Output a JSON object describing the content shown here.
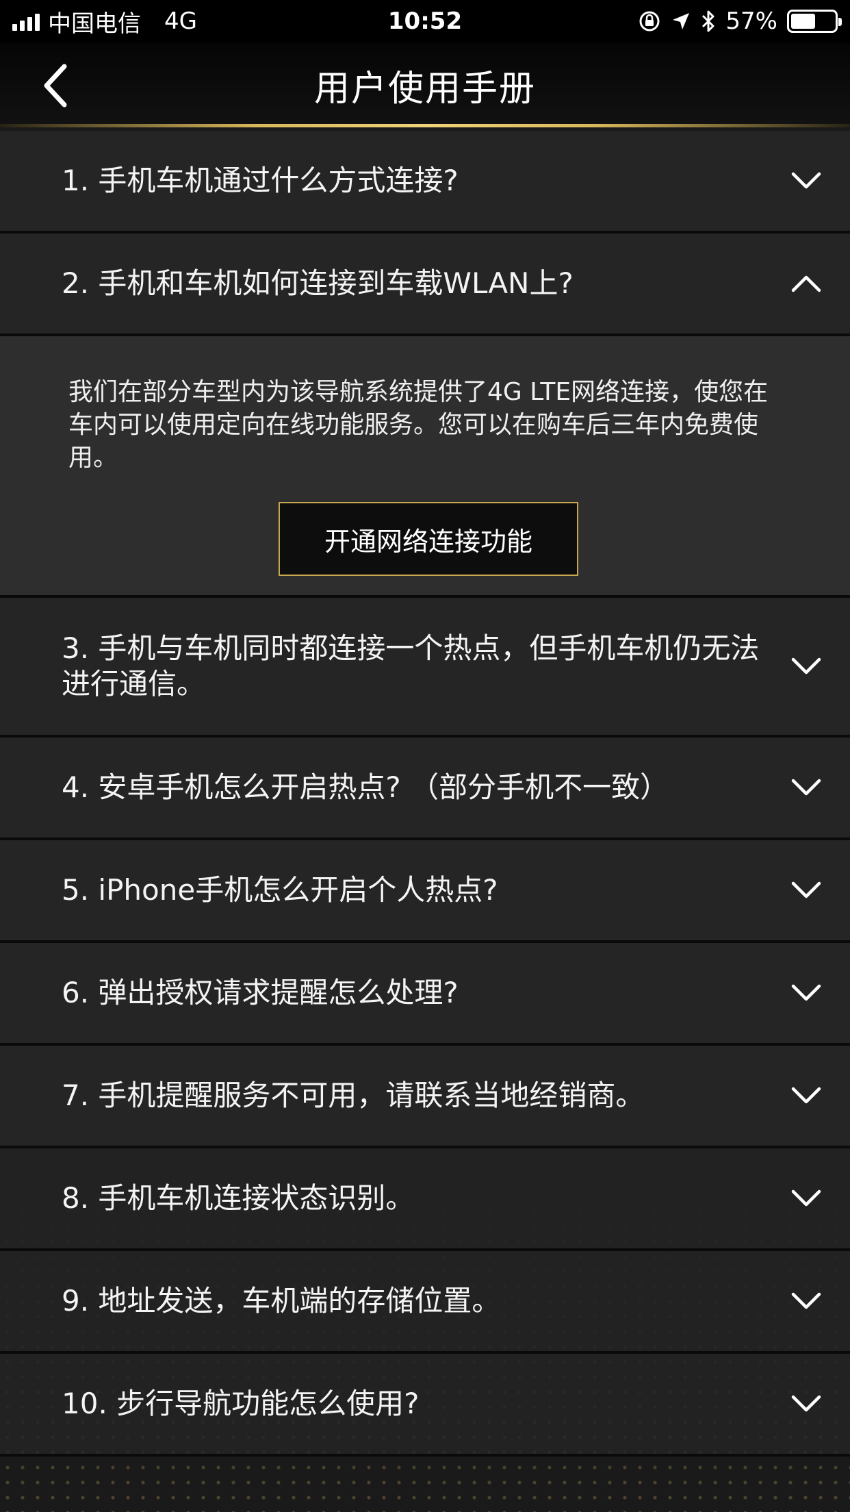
{
  "status_bar": {
    "carrier": "中国电信",
    "network": "4G",
    "time": "10:52",
    "battery": "57%",
    "battery_level": 0.57
  },
  "nav": {
    "title": "用户使用手册",
    "back_icon": "chevron-left-icon"
  },
  "faq": {
    "items": [
      {
        "question": "1. 手机车机通过什么方式连接?",
        "expanded": false
      },
      {
        "question": "2. 手机和车机如何连接到车载WLAN上?",
        "expanded": true
      },
      {
        "question": "3. 手机与车机同时都连接一个热点，但手机车机仍无法进行通信。",
        "expanded": false
      },
      {
        "question": "4. 安卓手机怎么开启热点? （部分手机不一致）",
        "expanded": false
      },
      {
        "question": "5. iPhone手机怎么开启个人热点?",
        "expanded": false
      },
      {
        "question": "6. 弹出授权请求提醒怎么处理?",
        "expanded": false
      },
      {
        "question": "7. 手机提醒服务不可用，请联系当地经销商。",
        "expanded": false
      },
      {
        "question": "8. 手机车机连接状态识别。",
        "expanded": false
      },
      {
        "question": "9. 地址发送，车机端的存储位置。",
        "expanded": false
      },
      {
        "question": "10. 步行导航功能怎么使用?",
        "expanded": false
      }
    ],
    "answer_2": {
      "text": "我们在部分车型内为该导航系统提供了4G LTE网络连接，使您在车内可以使用定向在线功能服务。您可以在购车后三年内免费使用。",
      "button_label": "开通网络连接功能"
    }
  },
  "colors": {
    "accent_gold": "#c8a84e",
    "background": "#252525"
  }
}
